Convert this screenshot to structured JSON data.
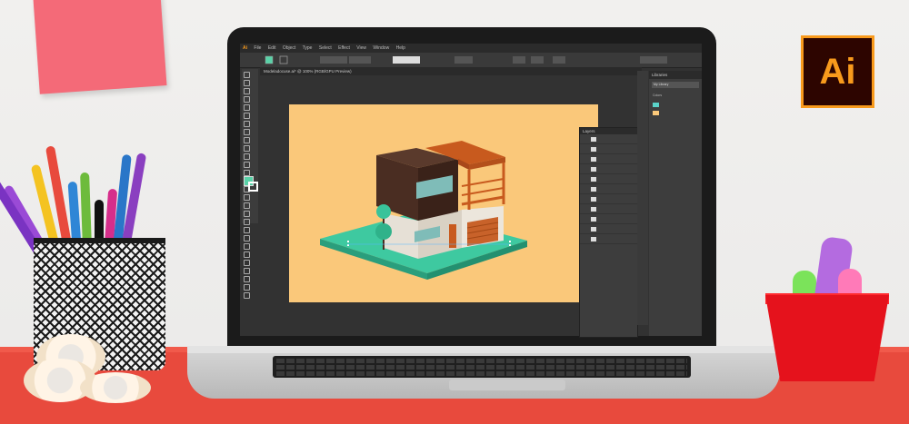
{
  "brand_logo": {
    "text": "Ai",
    "colors": {
      "border": "#f89a1c",
      "background": "#2d0500"
    }
  },
  "illustrator_ui": {
    "menu_items": [
      "Ai",
      "File",
      "Edit",
      "Object",
      "Type",
      "Select",
      "Effect",
      "View",
      "Window",
      "Help"
    ],
    "document_tab": "Modeladocuse.ai* @ 100% (RGB/GPU Preview)",
    "layers_panel_title": "Layers",
    "libraries_panel_title": "Libraries",
    "library_name": "My Library",
    "library_section": "Colors"
  },
  "scene": {
    "artboard_color": "#fac87a",
    "desk_color": "#e84a3d",
    "wall_color": "#eeedec"
  }
}
